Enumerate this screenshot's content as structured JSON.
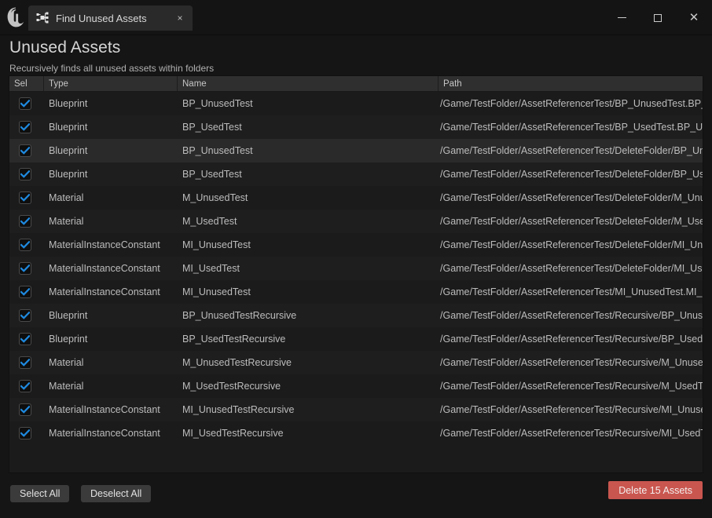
{
  "window": {
    "app_logo": "unreal-engine-logo",
    "tab": {
      "icon": "reference-viewer-icon",
      "title": "Find Unused Assets",
      "close_label": "×"
    },
    "controls": {
      "minimize": "minimize-icon",
      "maximize": "maximize-icon",
      "close": "✕"
    }
  },
  "header": {
    "title": "Unused Assets",
    "subtitle": "Recursively finds all unused assets within folders"
  },
  "table": {
    "columns": [
      {
        "key": "sel",
        "label": "Sel"
      },
      {
        "key": "type",
        "label": "Type"
      },
      {
        "key": "name",
        "label": "Name"
      },
      {
        "key": "path",
        "label": "Path"
      }
    ],
    "rows": [
      {
        "checked": true,
        "type": "Blueprint",
        "name": "BP_UnusedTest",
        "path": "/Game/TestFolder/AssetReferencerTest/BP_UnusedTest.BP_UnusedTest",
        "highlighted": false
      },
      {
        "checked": true,
        "type": "Blueprint",
        "name": "BP_UsedTest",
        "path": "/Game/TestFolder/AssetReferencerTest/BP_UsedTest.BP_UsedTest",
        "highlighted": false
      },
      {
        "checked": true,
        "type": "Blueprint",
        "name": "BP_UnusedTest",
        "path": "/Game/TestFolder/AssetReferencerTest/DeleteFolder/BP_UnusedTest.BP_UnusedTest",
        "highlighted": true
      },
      {
        "checked": true,
        "type": "Blueprint",
        "name": "BP_UsedTest",
        "path": "/Game/TestFolder/AssetReferencerTest/DeleteFolder/BP_UsedTest.BP_UsedTest",
        "highlighted": false
      },
      {
        "checked": true,
        "type": "Material",
        "name": "M_UnusedTest",
        "path": "/Game/TestFolder/AssetReferencerTest/DeleteFolder/M_UnusedTest.M_UnusedTest",
        "highlighted": false
      },
      {
        "checked": true,
        "type": "Material",
        "name": "M_UsedTest",
        "path": "/Game/TestFolder/AssetReferencerTest/DeleteFolder/M_UsedTest.M_UsedTest",
        "highlighted": false
      },
      {
        "checked": true,
        "type": "MaterialInstanceConstant",
        "name": "MI_UnusedTest",
        "path": "/Game/TestFolder/AssetReferencerTest/DeleteFolder/MI_UnusedTest.MI_UnusedTest",
        "highlighted": false
      },
      {
        "checked": true,
        "type": "MaterialInstanceConstant",
        "name": "MI_UsedTest",
        "path": "/Game/TestFolder/AssetReferencerTest/DeleteFolder/MI_UsedTest.MI_UsedTest",
        "highlighted": false
      },
      {
        "checked": true,
        "type": "MaterialInstanceConstant",
        "name": "MI_UnusedTest",
        "path": "/Game/TestFolder/AssetReferencerTest/MI_UnusedTest.MI_UnusedTest",
        "highlighted": false
      },
      {
        "checked": true,
        "type": "Blueprint",
        "name": "BP_UnusedTestRecursive",
        "path": "/Game/TestFolder/AssetReferencerTest/Recursive/BP_UnusedTestRecursive.BP_UnusedTestRecursive",
        "highlighted": false
      },
      {
        "checked": true,
        "type": "Blueprint",
        "name": "BP_UsedTestRecursive",
        "path": "/Game/TestFolder/AssetReferencerTest/Recursive/BP_UsedTestRecursive.BP_UsedTestRecursive",
        "highlighted": false
      },
      {
        "checked": true,
        "type": "Material",
        "name": "M_UnusedTestRecursive",
        "path": "/Game/TestFolder/AssetReferencerTest/Recursive/M_UnusedTestRecursive.M_UnusedTestRecursive",
        "highlighted": false
      },
      {
        "checked": true,
        "type": "Material",
        "name": "M_UsedTestRecursive",
        "path": "/Game/TestFolder/AssetReferencerTest/Recursive/M_UsedTestRecursive.M_UsedTestRecursive",
        "highlighted": false
      },
      {
        "checked": true,
        "type": "MaterialInstanceConstant",
        "name": "MI_UnusedTestRecursive",
        "path": "/Game/TestFolder/AssetReferencerTest/Recursive/MI_UnusedTestRecursive.MI_UnusedTestRecursive",
        "highlighted": false
      },
      {
        "checked": true,
        "type": "MaterialInstanceConstant",
        "name": "MI_UsedTestRecursive",
        "path": "/Game/TestFolder/AssetReferencerTest/Recursive/MI_UsedTestRecursive.MI_UsedTestRecursive",
        "highlighted": false
      }
    ]
  },
  "footer": {
    "select_all_label": "Select All",
    "deselect_all_label": "Deselect All",
    "delete_label": "Delete 15 Assets"
  },
  "colors": {
    "accent_checkbox": "#1f8ae0",
    "danger": "#c9564f",
    "row_highlight": "#2a2a2a",
    "text_primary": "#d6d6d6",
    "text_secondary": "#bcbcbc"
  }
}
